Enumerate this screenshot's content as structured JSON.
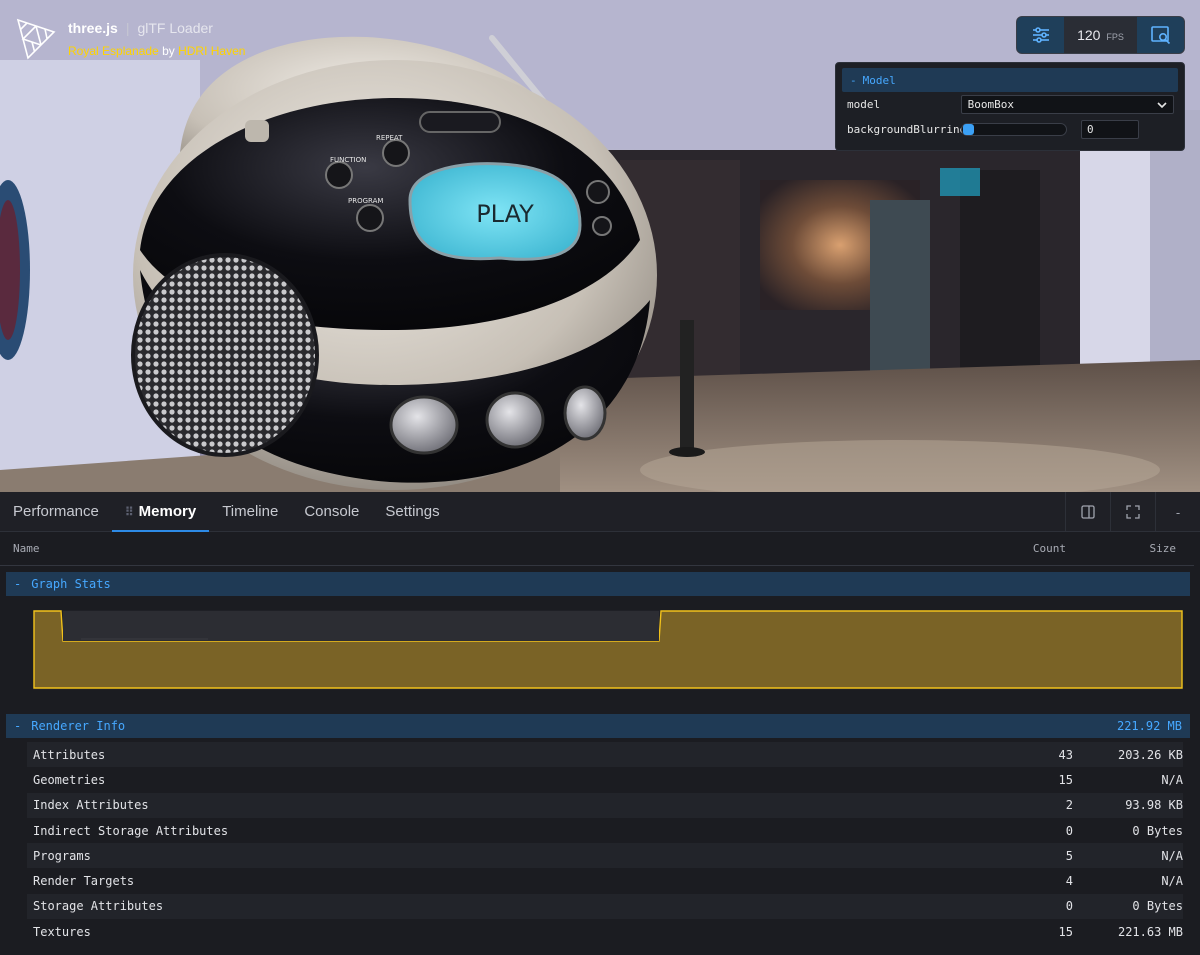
{
  "info": {
    "brand": "three.js",
    "separator": "|",
    "subtitle": "glTF Loader",
    "credit_env": "Royal Esplanade",
    "credit_by": " by ",
    "credit_source": "HDRI Haven"
  },
  "toolbar": {
    "fps_value": "120",
    "fps_unit": "FPS",
    "left_icon": "sliders-icon",
    "right_icon": "inspect-icon"
  },
  "gui": {
    "folder_label": "Model",
    "folder_toggle": "-",
    "model_label": "model",
    "model_value": "BoomBox",
    "blur_label": "backgroundBlurriness",
    "blur_value": "0",
    "blur_level": 0
  },
  "viewport": {
    "screen_text": "PLAY",
    "btn_function": "FUNCTION",
    "btn_repeat": "REPEAT",
    "btn_program": "PROGRAM"
  },
  "devtools": {
    "tabs": [
      {
        "label": "Performance",
        "active": false
      },
      {
        "label": "Memory",
        "active": true
      },
      {
        "label": "Timeline",
        "active": false
      },
      {
        "label": "Console",
        "active": false
      },
      {
        "label": "Settings",
        "active": false
      }
    ],
    "actions": [
      {
        "icon": "panel-icon"
      },
      {
        "icon": "fullscreen-icon"
      },
      {
        "icon": "minimize-icon",
        "label": "-"
      }
    ],
    "columns": {
      "name": "Name",
      "count": "Count",
      "size": "Size"
    },
    "graph_stats": {
      "toggle": "-",
      "title": "Graph Stats"
    },
    "renderer_info": {
      "toggle": "-",
      "title": "Renderer Info",
      "total": "221.92 MB",
      "rows": [
        {
          "name": "Attributes",
          "count": "43",
          "size": "203.26 KB"
        },
        {
          "name": "Geometries",
          "count": "15",
          "size": "N/A"
        },
        {
          "name": "Index Attributes",
          "count": "2",
          "size": "93.98 KB"
        },
        {
          "name": "Indirect Storage Attributes",
          "count": "0",
          "size": "0 Bytes"
        },
        {
          "name": "Programs",
          "count": "5",
          "size": "N/A"
        },
        {
          "name": "Render Targets",
          "count": "4",
          "size": "N/A"
        },
        {
          "name": "Storage Attributes",
          "count": "0",
          "size": "0 Bytes"
        },
        {
          "name": "Textures",
          "count": "15",
          "size": "221.63 MB"
        }
      ]
    }
  },
  "colors": {
    "accent": "#2d8ae6",
    "graph_fill": "#7a6326",
    "graph_line": "#f2c21b",
    "link": "#ffd400"
  }
}
